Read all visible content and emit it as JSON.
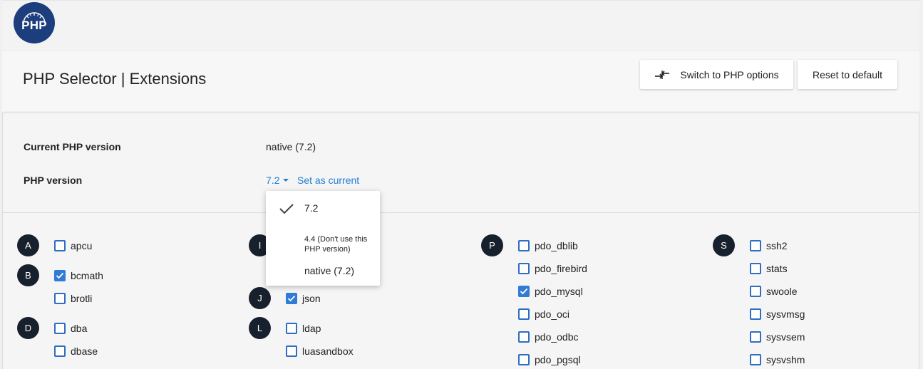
{
  "logo": {
    "text": "PHP",
    "color": "#1c3e7c"
  },
  "header": {
    "title": "PHP Selector | Extensions",
    "switch_button": "Switch to PHP options",
    "reset_button": "Reset to default"
  },
  "info": {
    "current_label": "Current PHP version",
    "current_value": "native (7.2)",
    "version_label": "PHP version",
    "version_value": "7.2",
    "set_current": "Set as current"
  },
  "dropdown": {
    "options": [
      {
        "label": "7.2",
        "selected": true
      },
      {
        "label": "4.4 (Don't use this PHP version)",
        "selected": false
      },
      {
        "label": "native (7.2)",
        "selected": false
      }
    ]
  },
  "letters": [
    "A",
    "B",
    "D",
    "I",
    "J",
    "L",
    "P",
    "S"
  ],
  "extensions": [
    {
      "name": "apcu",
      "checked": false
    },
    {
      "name": "bcmath",
      "checked": true
    },
    {
      "name": "brotli",
      "checked": false
    },
    {
      "name": "dba",
      "checked": false
    },
    {
      "name": "dbase",
      "checked": false
    },
    {
      "name": "json",
      "checked": true
    },
    {
      "name": "ldap",
      "checked": false
    },
    {
      "name": "luasandbox",
      "checked": false
    },
    {
      "name": "pdo_dblib",
      "checked": false
    },
    {
      "name": "pdo_firebird",
      "checked": false
    },
    {
      "name": "pdo_mysql",
      "checked": true
    },
    {
      "name": "pdo_oci",
      "checked": false
    },
    {
      "name": "pdo_odbc",
      "checked": false
    },
    {
      "name": "pdo_pgsql",
      "checked": false
    },
    {
      "name": "ssh2",
      "checked": false
    },
    {
      "name": "stats",
      "checked": false
    },
    {
      "name": "swoole",
      "checked": false
    },
    {
      "name": "sysvmsg",
      "checked": false
    },
    {
      "name": "sysvsem",
      "checked": false
    },
    {
      "name": "sysvshm",
      "checked": false
    }
  ],
  "colors": {
    "accent": "#1f7ed3",
    "checkbox": "#2f7bd6",
    "letter_badge": "#17202d"
  }
}
